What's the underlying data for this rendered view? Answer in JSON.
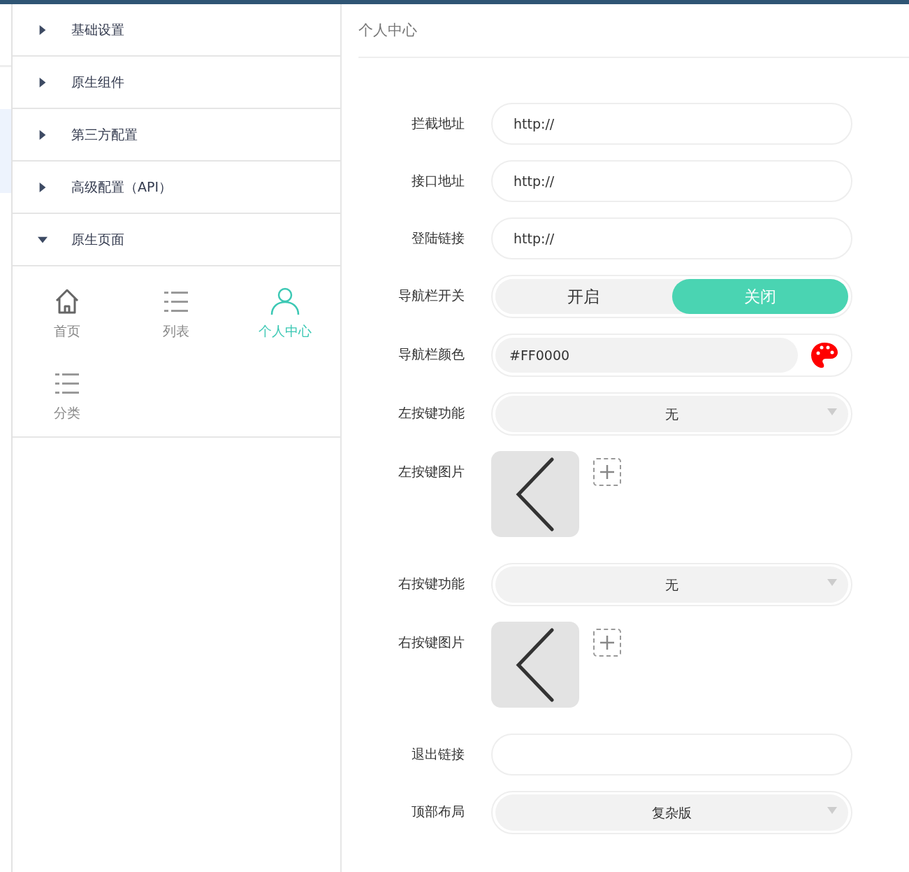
{
  "sidebar": {
    "sections": [
      {
        "label": "基础设置",
        "expanded": false
      },
      {
        "label": "原生组件",
        "expanded": false
      },
      {
        "label": "第三方配置",
        "expanded": false
      },
      {
        "label": "高级配置（API）",
        "expanded": false
      },
      {
        "label": "原生页面",
        "expanded": true,
        "pages": [
          {
            "label": "首页",
            "kind": "home",
            "selected": false
          },
          {
            "label": "列表",
            "kind": "list",
            "selected": false
          },
          {
            "label": "个人中心",
            "kind": "person",
            "selected": true
          },
          {
            "label": "分类",
            "kind": "list",
            "selected": false
          }
        ]
      }
    ]
  },
  "panel": {
    "title": "个人中心",
    "fields": [
      {
        "kind": "text",
        "label": "拦截地址",
        "value": "http://"
      },
      {
        "kind": "text",
        "label": "接口地址",
        "value": "http://"
      },
      {
        "kind": "text",
        "label": "登陆链接",
        "value": "http://"
      },
      {
        "kind": "toggle",
        "label": "导航栏开关",
        "options": [
          {
            "label": "开启",
            "selected": false
          },
          {
            "label": "关闭",
            "selected": true
          }
        ]
      },
      {
        "kind": "color",
        "label": "导航栏颜色",
        "value": "#FF0000"
      },
      {
        "kind": "select",
        "label": "左按键功能",
        "value": "无"
      },
      {
        "kind": "image",
        "label": "左按键图片"
      },
      {
        "kind": "select",
        "label": "右按键功能",
        "value": "无"
      },
      {
        "kind": "image",
        "label": "右按键图片"
      },
      {
        "kind": "text",
        "label": "退出链接"
      },
      {
        "kind": "select",
        "label": "顶部布局",
        "value": "复杂版"
      }
    ]
  }
}
